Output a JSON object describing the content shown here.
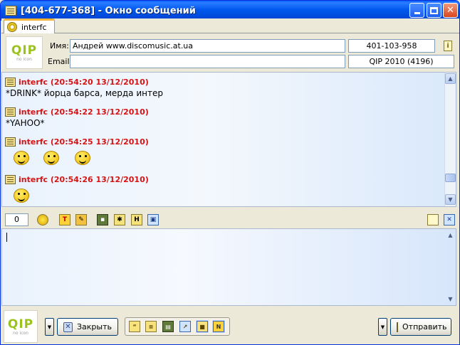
{
  "window": {
    "title": "[404-677-368] - Окно сообщений",
    "minimize_label": "minimize",
    "maximize_label": "maximize",
    "close_label": "close"
  },
  "tab": {
    "label": "interfc"
  },
  "logo": {
    "text": "QIP",
    "subtext": "no icon"
  },
  "contact": {
    "name_label": "Имя:",
    "name_value": "Андрей www.discomusic.at.ua",
    "email_label": "Email:",
    "email_value": "",
    "uin": "401-103-958",
    "client": "QIP 2010 (4196)"
  },
  "messages": [
    {
      "author": "interfc (20:54:20 13/12/2010)",
      "text": "*DRINK* йорца барса, мерда интер"
    },
    {
      "author": "interfc (20:54:22 13/12/2010)",
      "text": "*YAHOO*"
    },
    {
      "author": "interfc (20:54:25 13/12/2010)",
      "text": ""
    },
    {
      "author": "interfc (20:54:26 13/12/2010)",
      "text": ""
    }
  ],
  "editor": {
    "char_count": "0",
    "input_value": ""
  },
  "buttons": {
    "close_label": "Закрыть",
    "send_label": "Отправить"
  },
  "colors": {
    "title_bar": "#0058ee",
    "author_red": "#d41414",
    "logo_green": "#9bc21d"
  },
  "icons": {
    "smiley": "smiley-icon",
    "font": "font-icon",
    "color": "color-icon",
    "save": "save-icon",
    "history": "history-icon"
  }
}
